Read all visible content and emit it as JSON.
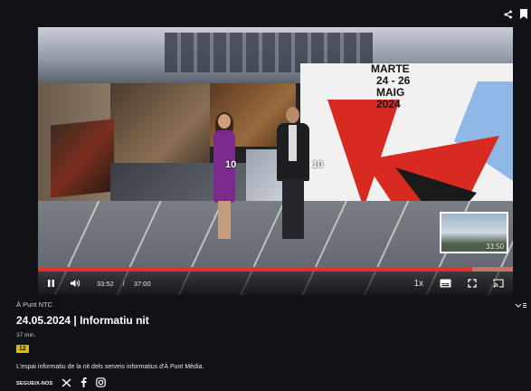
{
  "icons": {
    "share": "share-icon",
    "bookmark": "bookmark-icon",
    "play_pause": "pause-icon",
    "volume": "volume-icon",
    "subtitles": "subtitles-icon",
    "fullscreen": "fullscreen-icon",
    "cast": "cast-icon",
    "x": "x-icon",
    "facebook": "facebook-icon",
    "instagram": "instagram-icon",
    "expand": "chevron-down-icon"
  },
  "video": {
    "overlay_lines": [
      "MARTE",
      "24 - 26",
      "MAIG",
      "2024"
    ],
    "badge_left": "10",
    "badge_right": "10",
    "thumbnail_time": "33:50"
  },
  "player": {
    "progress_fraction": 0.915,
    "current_time": "33:52",
    "separator": "/",
    "total_time": "37:00",
    "speed": "1x"
  },
  "info": {
    "program": "À Punt NTC",
    "title": "24.05.2024 | Informatiu nit",
    "duration": "37 min.",
    "rating": "12",
    "description": "L'espai informatiu de la nit dels serveis informatius d'À Punt Mèdia.",
    "follow_label": "SEGUEIX-NOS"
  },
  "colors": {
    "accent_red": "#e1332a",
    "rating_yellow": "#e6b414",
    "background": "#101217"
  }
}
